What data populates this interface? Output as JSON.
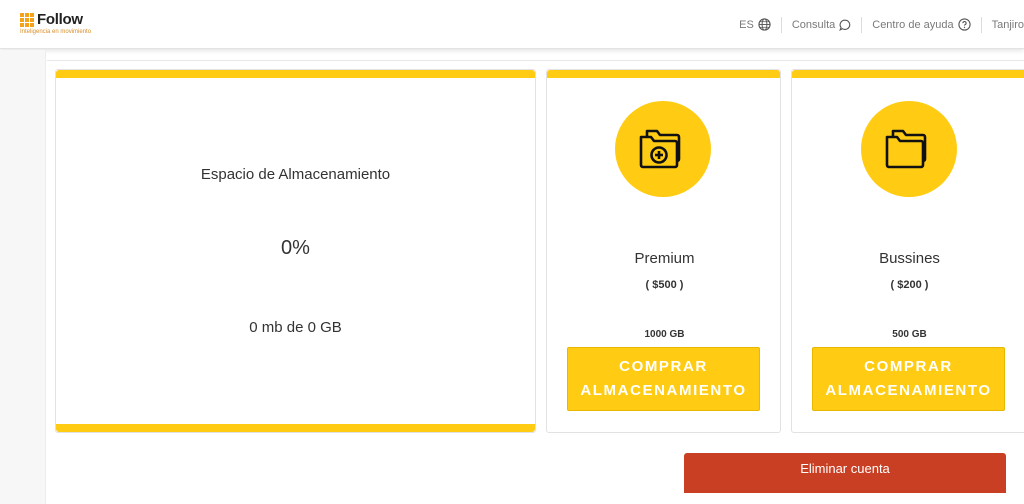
{
  "brand": {
    "name": "Follow",
    "tagline": "Inteligencia en movimiento",
    "accent": "#f4a21a"
  },
  "header": {
    "language": "ES",
    "consulta_label": "Consulta",
    "help_label": "Centro de ayuda",
    "user_name": "Tanjiro"
  },
  "storage": {
    "title": "Espacio de Almacenamiento",
    "percent": "0%",
    "usage": "0 mb de 0 GB"
  },
  "plans": [
    {
      "name": "Premium",
      "price": "( $500 )",
      "size": "1000 GB",
      "button": "COMPRAR ALMACENAMIENTO",
      "icon": "folder-plus-icon"
    },
    {
      "name": "Bussines",
      "price": "( $200 )",
      "size": "500 GB",
      "button": "COMPRAR ALMACENAMIENTO",
      "icon": "folders-icon"
    }
  ],
  "delete_account": "Eliminar cuenta",
  "colors": {
    "yellow": "#ffcc13",
    "danger": "#c93f23",
    "text": "#333333"
  }
}
